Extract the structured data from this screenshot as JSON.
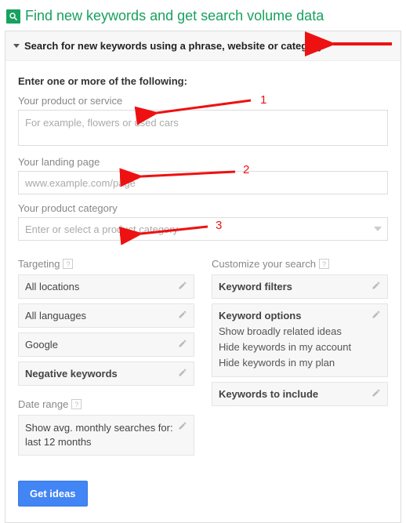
{
  "header": {
    "title": "Find new keywords and get search volume data"
  },
  "accordion": {
    "title": "Search for new keywords using a phrase, website or category"
  },
  "form": {
    "prompt": "Enter one or more of the following:",
    "product": {
      "label": "Your product or service",
      "placeholder": "For example, flowers or used cars"
    },
    "landing": {
      "label": "Your landing page",
      "placeholder": "www.example.com/page"
    },
    "category": {
      "label": "Your product category",
      "placeholder": "Enter or select a product category"
    }
  },
  "targeting": {
    "heading": "Targeting",
    "items": [
      "All locations",
      "All languages",
      "Google"
    ],
    "negative": "Negative keywords"
  },
  "daterange": {
    "heading": "Date range",
    "text": "Show avg. monthly searches for: last 12 months"
  },
  "customize": {
    "heading": "Customize your search",
    "filters": "Keyword filters",
    "options": {
      "title": "Keyword options",
      "lines": [
        "Show broadly related ideas",
        "Hide keywords in my account",
        "Hide keywords in my plan"
      ]
    },
    "include": "Keywords to include"
  },
  "button": {
    "label": "Get ideas"
  },
  "annotations": {
    "n1": "1",
    "n2": "2",
    "n3": "3"
  }
}
